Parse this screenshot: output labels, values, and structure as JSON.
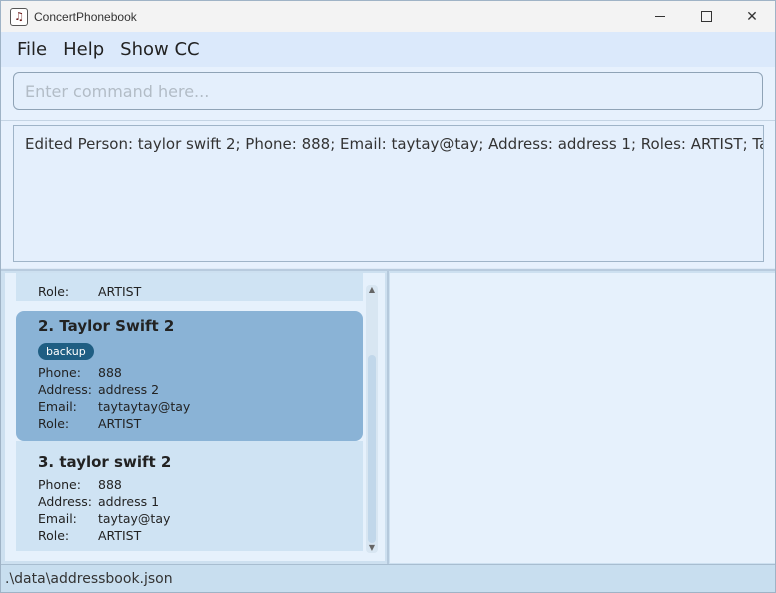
{
  "window": {
    "title": "ConcertPhonebook",
    "app_icon": "music-note-icon",
    "controls": {
      "minimize": "minimize-icon",
      "maximize": "maximize-icon",
      "close": "✕"
    }
  },
  "menu": {
    "items": [
      "File",
      "Help",
      "Show CC"
    ]
  },
  "command": {
    "value": "",
    "placeholder": "Enter command here..."
  },
  "result": {
    "text": "Edited Person: taylor swift 2; Phone: 888; Email: taytay@tay; Address: address 1; Roles: ARTIST; Tags:"
  },
  "person_list": {
    "labels": {
      "phone": "Phone:",
      "address": "Address:",
      "email": "Email:",
      "role": "Role:"
    },
    "partial_card": {
      "role": "ARTIST"
    },
    "cards": [
      {
        "index": "2.",
        "name": "Taylor Swift 2",
        "tags": [
          "backup"
        ],
        "phone": "888",
        "address": "address 2",
        "email": "taytaytay@tay",
        "role": "ARTIST",
        "selected": true
      },
      {
        "index": "3.",
        "name": "taylor swift 2",
        "tags": [],
        "phone": "888",
        "address": "address 1",
        "email": "taytay@tay",
        "role": "ARTIST",
        "selected": false
      }
    ]
  },
  "status": {
    "path": ".\\data\\addressbook.json"
  },
  "colors": {
    "selected_card": "#8ab3d6",
    "tag": "#1f5e83",
    "card": "#cfe3f3"
  }
}
